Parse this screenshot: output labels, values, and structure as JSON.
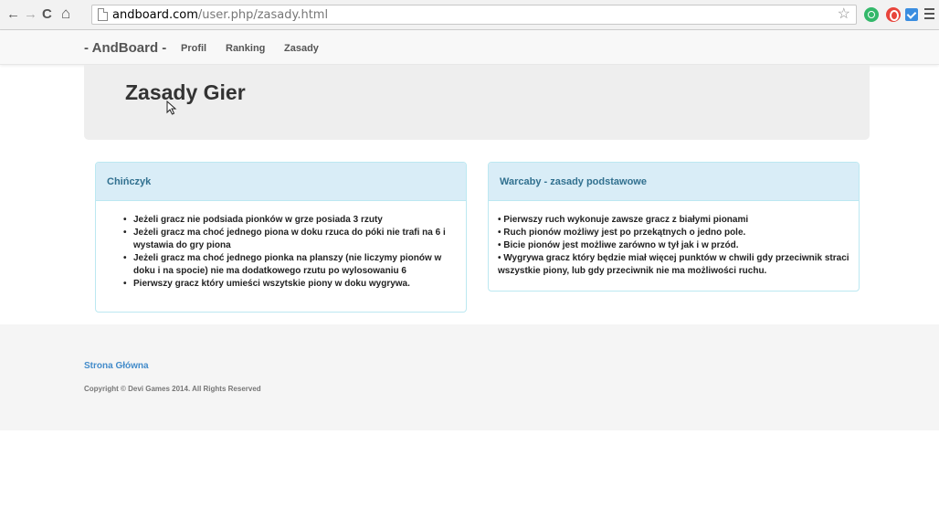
{
  "browser": {
    "back": "←",
    "forward": "→",
    "reload": "C",
    "home": "⌂",
    "url_host": "andboard.com",
    "url_path": "/user.php/zasady.html",
    "star": "☆"
  },
  "navbar": {
    "brand": "- AndBoard -",
    "links": [
      "Profil",
      "Ranking",
      "Zasady"
    ]
  },
  "jumbotron": {
    "title": "Zasady Gier"
  },
  "panels": [
    {
      "heading": "Chińczyk",
      "items": [
        "Jeżeli gracz nie podsiada pionków w grze posiada 3 rzuty",
        "Jeżeli gracz ma choć jednego piona w doku rzuca do póki nie trafi na 6 i wystawia do gry piona",
        "Jeżeli gracz ma choć jednego pionka na planszy (nie liczymy pionów w doku i na spocie) nie ma dodatkowego rzutu po wylosowaniu 6",
        "Pierwszy gracz który umieści wszytskie piony w doku wygrywa."
      ]
    },
    {
      "heading": "Warcaby - zasady podstawowe",
      "lines": [
        "• Pierwszy ruch wykonuje zawsze gracz z białymi pionami",
        "• Ruch pionów możliwy jest po przekątnych o jedno pole.",
        "• Bicie pionów jest możliwe zarówno w tył jak i w przód.",
        "• Wygrywa gracz który będzie miał więcej punktów w chwili gdy przeciwnik straci wszystkie piony, lub gdy przeciwnik nie ma możliwości ruchu."
      ]
    }
  ],
  "footer": {
    "link": "Strona Główna",
    "copyright": "Copyright © Devi Games 2014. All Rights Reserved"
  },
  "colors": {
    "panel_heading_bg": "#d9edf7",
    "panel_heading_text": "#31708f",
    "link": "#428bca",
    "jumbotron_bg": "#eeeeee"
  }
}
